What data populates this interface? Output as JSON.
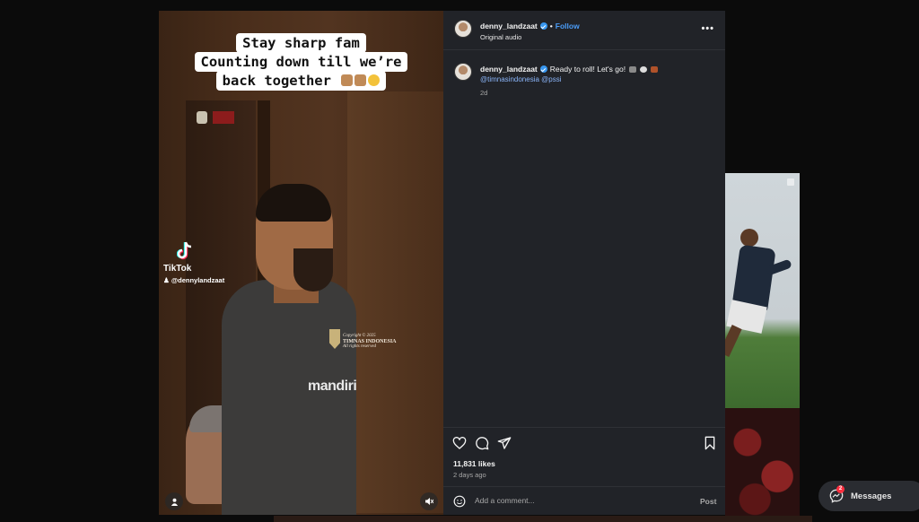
{
  "video": {
    "caption_lines": [
      "Stay sharp fam",
      "Counting down till we’re",
      "back together"
    ],
    "tiktok_brand": "TikTok",
    "tiktok_handle": "@dennylandzaat",
    "shirt_logo": "mandiri",
    "copyright_line1": "Copyright © 2025",
    "copyright_brand": "TIMNAS INDONESIA",
    "copyright_line2": "All rights reserved"
  },
  "post": {
    "username": "denny_landzaat",
    "follow_label": "Follow",
    "audio": "Original audio",
    "more_label": "•••",
    "caption_text": "Ready to roll! Let's go!",
    "mentions": "@timnasindonesia @pssi",
    "caption_age": "2d",
    "likes": "11,831 likes",
    "posted": "2 days ago",
    "comment_placeholder": "Add a comment...",
    "post_label": "Post"
  },
  "messages": {
    "label": "Messages",
    "badge": "2"
  },
  "colors": {
    "panel_bg": "#212328",
    "link": "#4a9cf7",
    "verified": "#3897f0",
    "badge": "#ff3040"
  },
  "icons": [
    "heart-icon",
    "comment-icon",
    "share-icon",
    "bookmark-icon",
    "emoji-icon",
    "user-icon",
    "mute-icon",
    "tiktok-icon",
    "messenger-icon",
    "verified-icon"
  ]
}
